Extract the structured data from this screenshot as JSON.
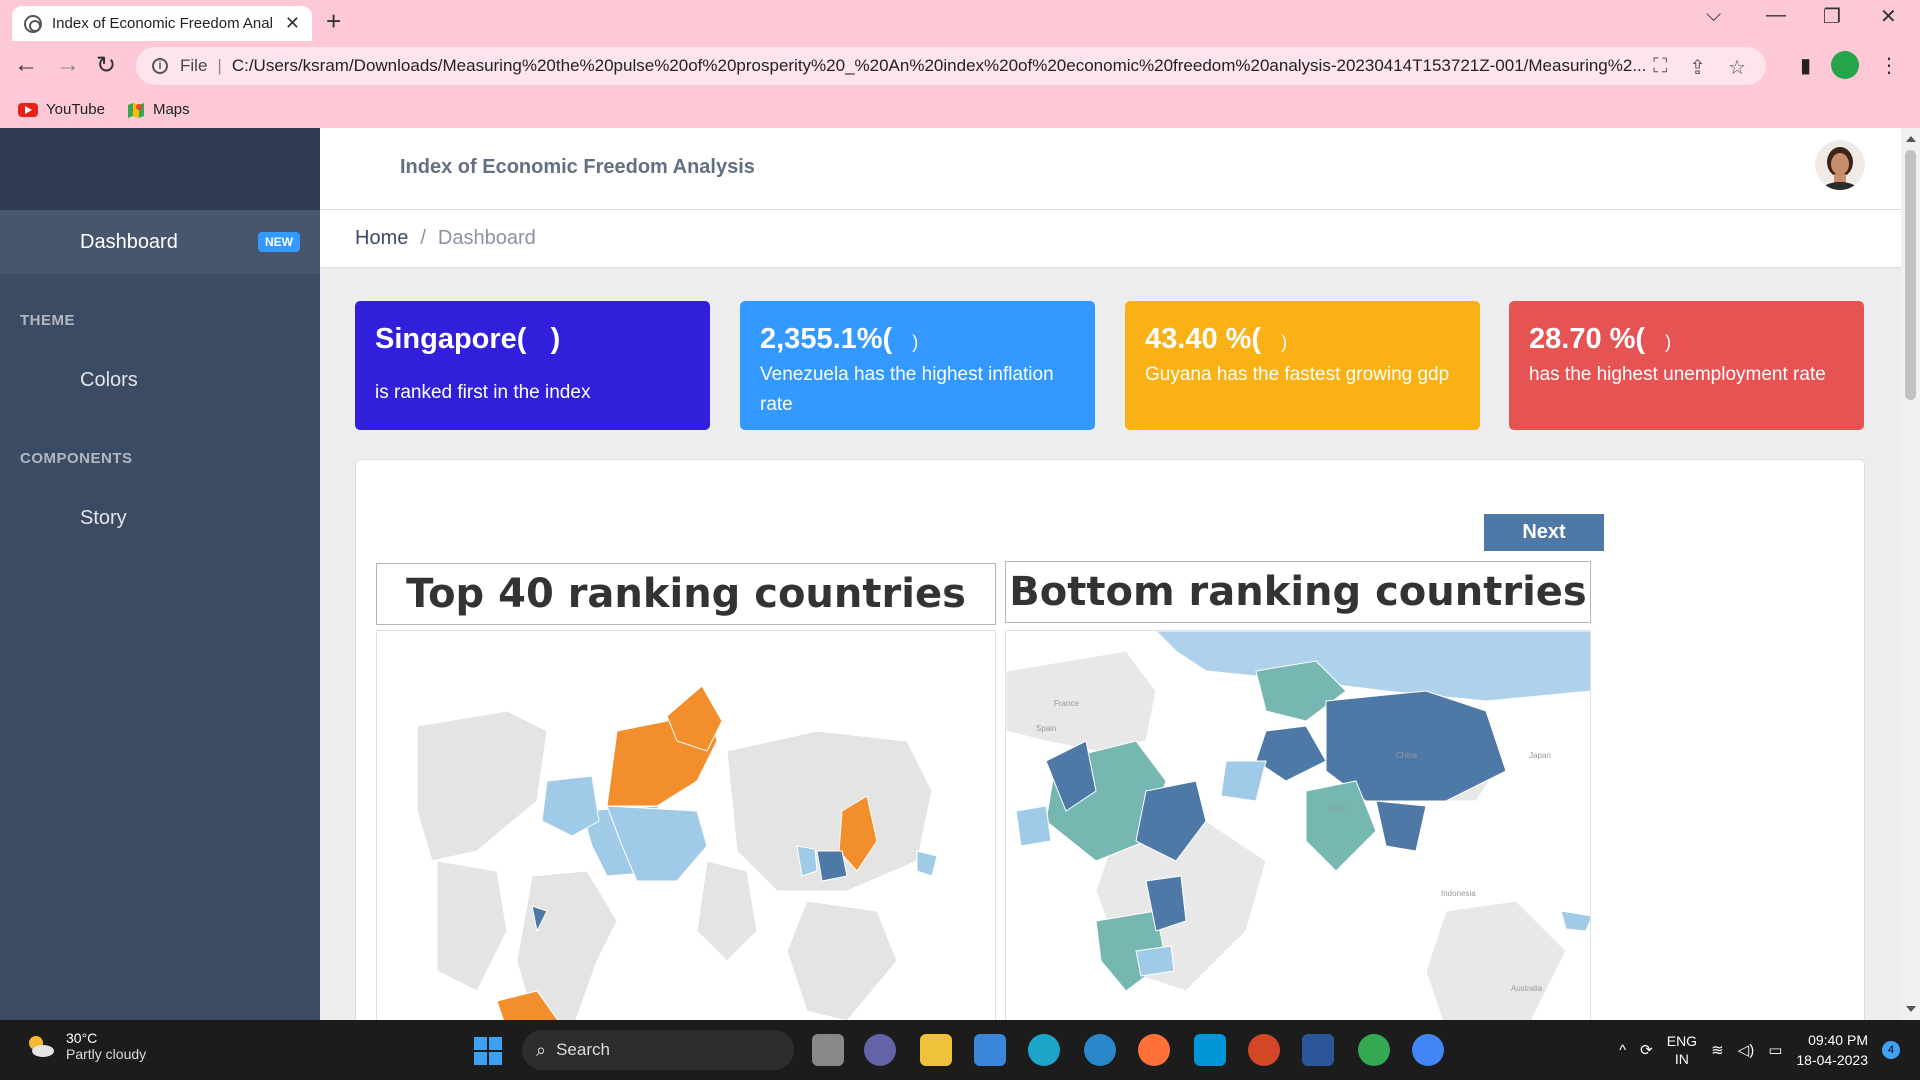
{
  "browser": {
    "tab_title": "Index of Economic Freedom Anal",
    "file_label": "File",
    "url": "C:/Users/ksram/Downloads/Measuring%20the%20pulse%20of%20prosperity%20_%20An%20index%20of%20economic%20freedom%20analysis-20230414T153721Z-001/Measuring%2...",
    "bookmarks": [
      {
        "label": "YouTube",
        "icon": "youtube-icon"
      },
      {
        "label": "Maps",
        "icon": "maps-icon"
      }
    ]
  },
  "header": {
    "title": "Index of Economic Freedom Analysis"
  },
  "breadcrumb": {
    "home": "Home",
    "separator": "/",
    "current": "Dashboard"
  },
  "sidebar": {
    "dashboard": {
      "label": "Dashboard",
      "badge": "NEW"
    },
    "sections": [
      {
        "title": "THEME",
        "items": [
          {
            "label": "Colors"
          }
        ]
      },
      {
        "title": "COMPONENTS",
        "items": [
          {
            "label": "Story"
          }
        ]
      }
    ]
  },
  "cards": [
    {
      "big": "Singapore(",
      "paren": ")",
      "desc": "is ranked first in the index",
      "color": "#321fdb"
    },
    {
      "big": "2,355.1%(",
      "paren": ")",
      "desc": "Venezuela has the highest inflation rate",
      "color": "#3399ff"
    },
    {
      "big": "43.40 %(",
      "paren": ")",
      "desc": "Guyana has the fastest growing gdp",
      "color": "#f9b115"
    },
    {
      "big": "28.70 %(",
      "paren": ")",
      "desc": "has the highest unemployment rate",
      "color": "#e55353"
    }
  ],
  "story": {
    "next_label": "Next",
    "left_title": "Top 40 ranking countries",
    "right_title": "Bottom ranking countries",
    "map_labels": {
      "france": "France",
      "spain": "Spain",
      "japan": "Japan",
      "china": "China",
      "india": "India",
      "indonesia": "Indonesia",
      "australia": "Australia"
    },
    "colors": {
      "top_rank": "#f28e2b",
      "light_blue": "#a0cbe8",
      "mid_blue": "#4e79a7",
      "teal": "#76b7b2",
      "grey": "#e8e8e8"
    }
  },
  "taskbar": {
    "temperature": "30°C",
    "condition": "Partly cloudy",
    "search_label": "Search",
    "lang1": "ENG",
    "lang2": "IN",
    "time": "09:40 PM",
    "date": "18-04-2023",
    "notifications": "4"
  }
}
